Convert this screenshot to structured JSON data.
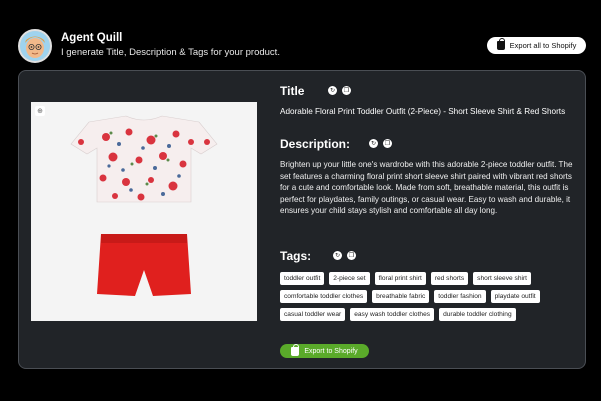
{
  "agent": {
    "name": "Agent Quill",
    "description": "I generate Title, Description & Tags for your product.",
    "export_all_label": "Export all to Shopify"
  },
  "product": {
    "title_label": "Title",
    "title": "Adorable Floral Print Toddler Outfit (2-Piece) - Short Sleeve Shirt & Red Shorts",
    "description_label": "Description:",
    "description": "Brighten up your little one's wardrobe with this adorable 2-piece toddler outfit. The set features a charming floral print short sleeve shirt paired with vibrant red shorts for a cute and comfortable look. Made from soft, breathable material, this outfit is perfect for playdates, family outings, or casual wear. Easy to wash and durable, it ensures your child stays stylish and comfortable all day long.",
    "tags_label": "Tags:",
    "tags": [
      "toddler outfit",
      "2-piece set",
      "floral print shirt",
      "red shorts",
      "short sleeve shirt",
      "comfortable toddler clothes",
      "breathable fabric",
      "toddler fashion",
      "playdate outfit",
      "casual toddler wear",
      "easy wash toddler clothes",
      "durable toddler clothing"
    ],
    "export_label": "Export to Shopify"
  },
  "icons": {
    "regenerate": "regenerate-icon",
    "copy": "copy-icon",
    "zoom": "zoom-icon",
    "shopify": "shopify-bag-icon"
  },
  "colors": {
    "card_bg": "#212428",
    "export_green": "#5aaa2a",
    "shorts_red": "#e0201e"
  }
}
